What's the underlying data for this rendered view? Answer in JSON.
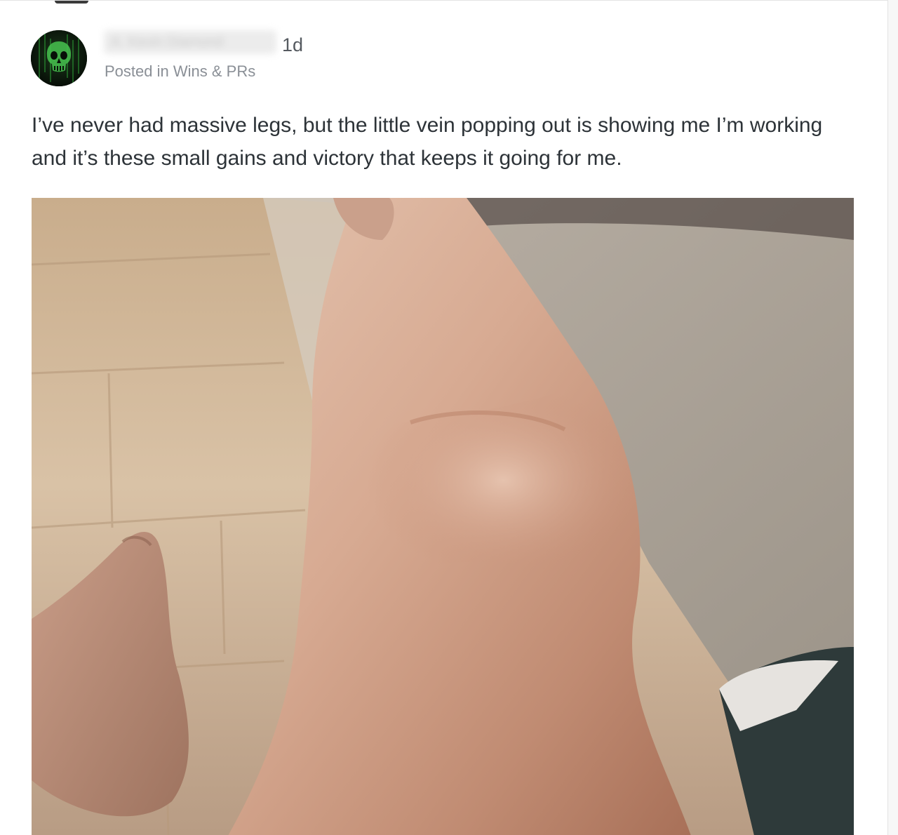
{
  "post": {
    "author_name": "A. Kevin Diamond",
    "time_ago": "1d",
    "posted_in_prefix": "Posted in",
    "category": "Wins & PRs",
    "body": "I’ve never had massive legs, but the little vein popping out is showing me I’m working and it’s these small gains and victory that keeps it going for me."
  },
  "icons": {
    "avatar": "skull-emblem-avatar"
  },
  "colors": {
    "text_primary": "#2d3338",
    "text_muted": "#8a8f96",
    "avatar_accent": "#3bd14a"
  }
}
